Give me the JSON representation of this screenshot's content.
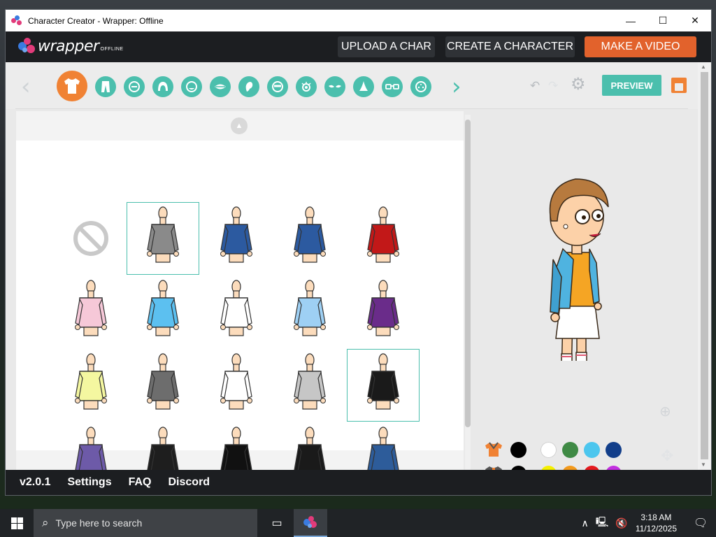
{
  "window": {
    "title": "Character Creator - Wrapper: Offline",
    "minimize": "—",
    "maximize": "☐",
    "close": "✕"
  },
  "header": {
    "logo_text": "wrapper",
    "logo_sub": "OFFLINE",
    "upload_label": "UPLOAD A CHAR",
    "create_label": "CREATE A CHARACTER",
    "video_label": "MAKE A VIDEO"
  },
  "toolbar": {
    "active_category": "upper-body",
    "categories": [
      "upper-body",
      "lower-body",
      "face-shape",
      "hair",
      "mouth",
      "lips",
      "ear",
      "eye-brow",
      "eye",
      "wrinkle",
      "nose",
      "glasses",
      "facial-marks"
    ],
    "preview_label": "PREVIEW",
    "accent_color": "#4bbfad",
    "active_color": "#f08234"
  },
  "parts": {
    "selected_items": [
      "grey-blazer-top",
      "black-spiked-crop-top"
    ],
    "items": [
      {
        "id": "none",
        "label": "none"
      },
      {
        "id": "grey-blazer-top",
        "color": "#8a8a8a"
      },
      {
        "id": "blue-tank",
        "color": "#2c5aa0"
      },
      {
        "id": "blue-halter",
        "color": "#2c5aa0"
      },
      {
        "id": "red-tube-top",
        "color": "#c21818"
      },
      {
        "id": "pink-nurse-shirt",
        "color": "#f6c8d8"
      },
      {
        "id": "light-blue-tee",
        "color": "#5cc0f0"
      },
      {
        "id": "white-nurse-shirt",
        "color": "#ffffff"
      },
      {
        "id": "light-blue-shirt",
        "color": "#9ed0f4"
      },
      {
        "id": "purple-jacket",
        "color": "#6a2c8a"
      },
      {
        "id": "yellow-cardigan",
        "color": "#f4f7a0"
      },
      {
        "id": "grey-vest-tie",
        "color": "#6d6d6d"
      },
      {
        "id": "white-shirt-tie",
        "color": "#ffffff"
      },
      {
        "id": "grey-red-sport-top",
        "color": "#c6c6c6"
      },
      {
        "id": "black-spiked-crop-top",
        "color": "#1a1a1a"
      },
      {
        "id": "purple-crop-top",
        "color": "#6d5aa8"
      },
      {
        "id": "black-red-top",
        "color": "#1e1e1e"
      },
      {
        "id": "black-halter-dress",
        "color": "#111111"
      },
      {
        "id": "black-pink-corset",
        "color": "#1a1a1a"
      },
      {
        "id": "blue-hoodie",
        "color": "#2d5c9a"
      }
    ]
  },
  "colors": {
    "upper_row": [
      "#000000",
      "#ffffff",
      "#3f8a45",
      "#4cc6ee",
      "#123e8a"
    ],
    "lower_row": [
      "#000000",
      "#f5f000",
      "#f39a1c",
      "#e5191e",
      "#c22fe0"
    ]
  },
  "footer": {
    "version": "v2.0.1",
    "settings": "Settings",
    "faq": "FAQ",
    "discord": "Discord"
  },
  "taskbar": {
    "search_placeholder": "Type here to search",
    "time": "3:18 AM",
    "date": "11/12/2025"
  }
}
